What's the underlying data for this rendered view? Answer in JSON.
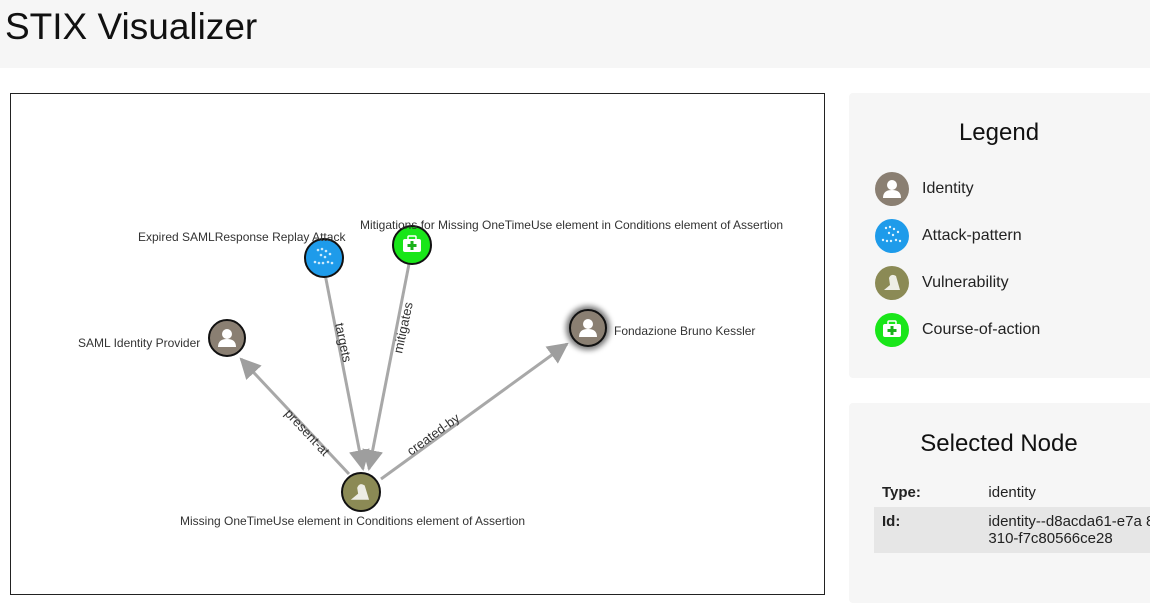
{
  "header": {
    "title": "STIX Visualizer"
  },
  "graph": {
    "nodes": [
      {
        "id": "attack",
        "type": "attack-pattern",
        "label": "Expired SAMLResponse Replay Attack"
      },
      {
        "id": "coa",
        "type": "course-of-action",
        "label": "Mitigations for Missing OneTimeUse element in Conditions element of Assertion"
      },
      {
        "id": "saml",
        "type": "identity",
        "label": "SAML Identity Provider"
      },
      {
        "id": "fbk",
        "type": "identity",
        "label": "Fondazione Bruno Kessler"
      },
      {
        "id": "vuln",
        "type": "vulnerability",
        "label": "Missing OneTimeUse element in Conditions element of Assertion"
      }
    ],
    "edges": [
      {
        "from": "attack",
        "to": "vuln",
        "label": "targets"
      },
      {
        "from": "coa",
        "to": "vuln",
        "label": "mitigates"
      },
      {
        "from": "vuln",
        "to": "saml",
        "label": "present-at"
      },
      {
        "from": "vuln",
        "to": "fbk",
        "label": "created-by"
      }
    ]
  },
  "legend": {
    "title": "Legend",
    "items": [
      {
        "label": "Identity",
        "icon": "identity-icon",
        "color": "#8a7f72"
      },
      {
        "label": "Attack-pattern",
        "icon": "attack-pattern-icon",
        "color": "#1e9bea"
      },
      {
        "label": "Vulnerability",
        "icon": "vulnerability-icon",
        "color": "#8b8a55"
      },
      {
        "label": "Course-of-action",
        "icon": "course-of-action-icon",
        "color": "#19e619"
      }
    ]
  },
  "selected": {
    "title": "Selected Node",
    "rows": [
      {
        "key": "Type:",
        "value": "identity"
      },
      {
        "key": "Id:",
        "value": "identity--d8acda61-e7a 8310-f7c80566ce28"
      }
    ]
  }
}
